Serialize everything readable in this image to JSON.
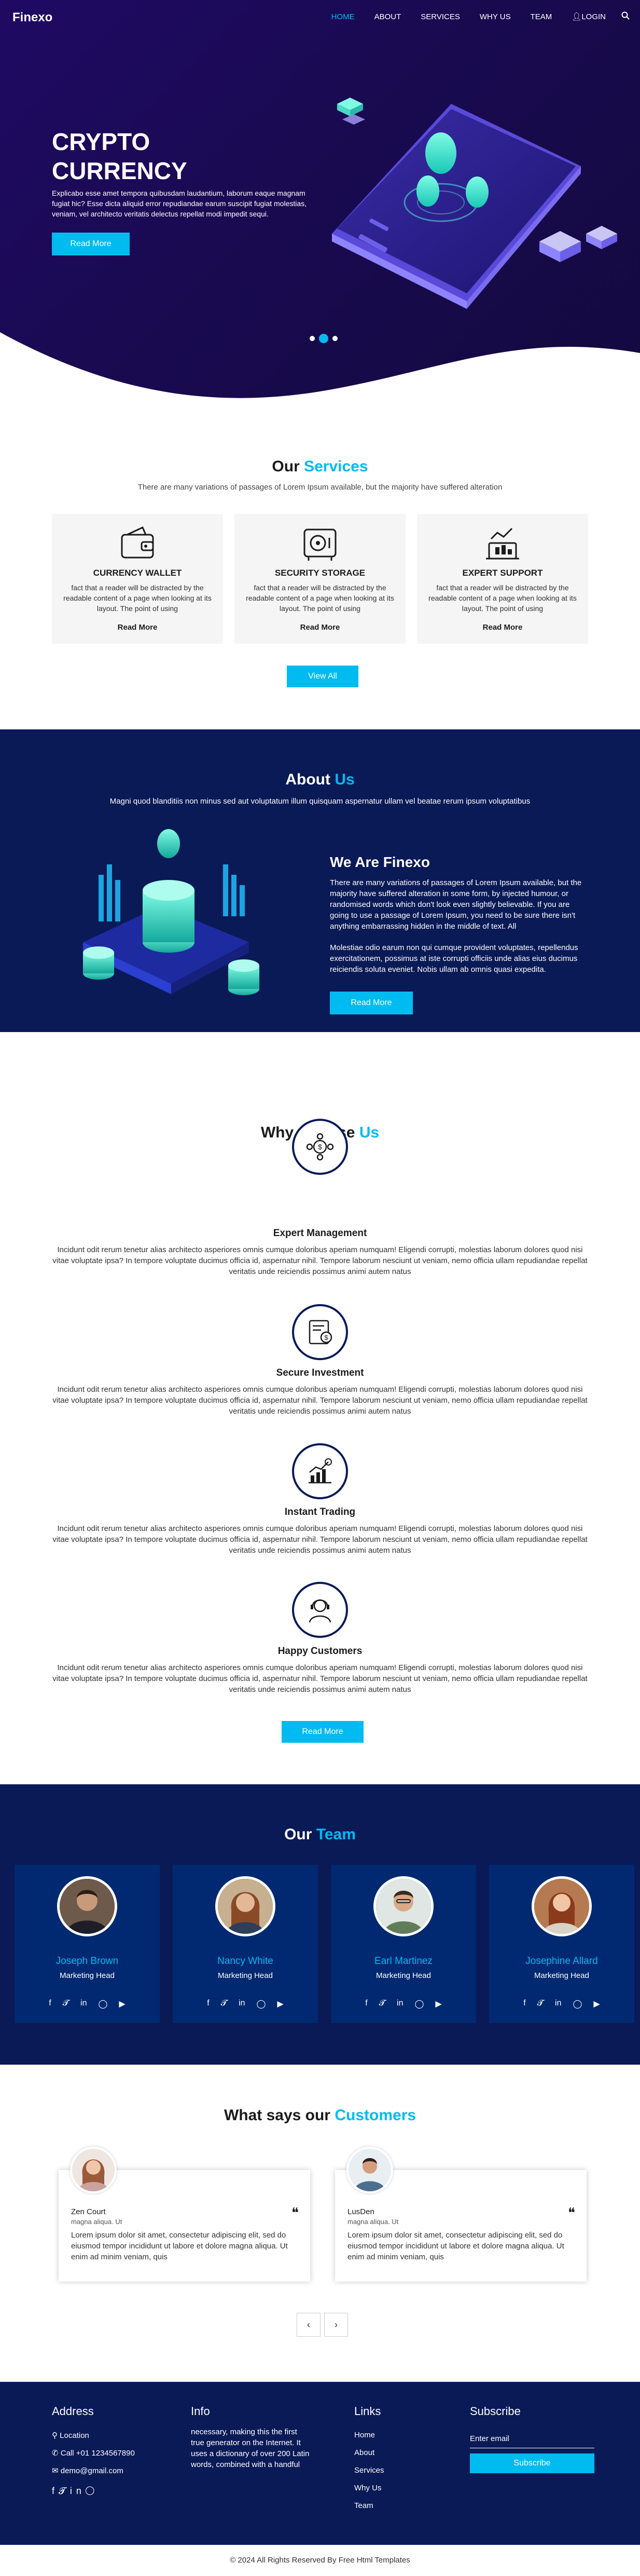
{
  "header": {
    "logo": "Finexo",
    "nav": [
      "HOME",
      "ABOUT",
      "SERVICES",
      "WHY US",
      "TEAM"
    ],
    "login": "LOGIN",
    "user_icon": "user-icon",
    "search_icon": "search-icon"
  },
  "hero": {
    "title_line1": "CRYPTO",
    "title_line2": "CURRENCY",
    "text": "Explicabo esse amet tempora quibusdam laudantium, laborum eaque magnam fugiat hic? Esse dicta aliquid error repudiandae earum suscipit fugiat molestias, veniam, vel architecto veritatis delectus repellat modi impedit sequi.",
    "button": "Read More",
    "carousel_active_index": 1
  },
  "services": {
    "title_a": "Our",
    "title_b": "Services",
    "subtitle": "There are many variations of passages of Lorem Ipsum available, but the majority have suffered alteration",
    "cards": [
      {
        "title": "CURRENCY WALLET",
        "desc": "fact that a reader will be distracted by the readable content of a page when looking at its layout. The point of using",
        "link": "Read More"
      },
      {
        "title": "SECURITY STORAGE",
        "desc": "fact that a reader will be distracted by the readable content of a page when looking at its layout. The point of using",
        "link": "Read More"
      },
      {
        "title": "EXPERT SUPPORT",
        "desc": "fact that a reader will be distracted by the readable content of a page when looking at its layout. The point of using",
        "link": "Read More"
      }
    ],
    "button": "View All"
  },
  "about": {
    "title_a": "About",
    "title_b": "Us",
    "subtitle": "Magni quod blanditiis non minus sed aut voluptatum illum quisquam aspernatur ullam vel beatae rerum ipsum voluptatibus",
    "heading": "We Are Finexo",
    "p1": "There are many variations of passages of Lorem Ipsum available, but the majority have suffered alteration in some form, by injected humour, or randomised words which don't look even slightly believable. If you are going to use a passage of Lorem Ipsum, you need to be sure there isn't anything embarrassing hidden in the middle of text. All",
    "p2": "Molestiae odio earum non qui cumque provident voluptates, repellendus exercitationem, possimus at iste corrupti officiis unde alias eius ducimus reiciendis soluta eveniet. Nobis ullam ab omnis quasi expedita.",
    "button": "Read More"
  },
  "why": {
    "title_a": "Why Choose",
    "title_b": "Us",
    "items": [
      {
        "title": "Expert Management",
        "desc": "Incidunt odit rerum tenetur alias architecto asperiores omnis cumque doloribus aperiam numquam! Eligendi corrupti, molestias laborum dolores quod nisi vitae voluptate ipsa? In tempore voluptate ducimus officia id, aspernatur nihil. Tempore laborum nesciunt ut veniam, nemo officia ullam repudiandae repellat veritatis unde reiciendis possimus animi autem natus",
        "icon": "management-icon"
      },
      {
        "title": "Secure Investment",
        "desc": "Incidunt odit rerum tenetur alias architecto asperiores omnis cumque doloribus aperiam numquam! Eligendi corrupti, molestias laborum dolores quod nisi vitae voluptate ipsa? In tempore voluptate ducimus officia id, aspernatur nihil. Tempore laborum nesciunt ut veniam, nemo officia ullam repudiandae repellat veritatis unde reiciendis possimus animi autem natus",
        "icon": "investment-icon"
      },
      {
        "title": "Instant Trading",
        "desc": "Incidunt odit rerum tenetur alias architecto asperiores omnis cumque doloribus aperiam numquam! Eligendi corrupti, molestias laborum dolores quod nisi vitae voluptate ipsa? In tempore voluptate ducimus officia id, aspernatur nihil. Tempore laborum nesciunt ut veniam, nemo officia ullam repudiandae repellat veritatis unde reiciendis possimus animi autem natus",
        "icon": "trading-icon"
      },
      {
        "title": "Happy Customers",
        "desc": "Incidunt odit rerum tenetur alias architecto asperiores omnis cumque doloribus aperiam numquam! Eligendi corrupti, molestias laborum dolores quod nisi vitae voluptate ipsa? In tempore voluptate ducimus officia id, aspernatur nihil. Tempore laborum nesciunt ut veniam, nemo officia ullam repudiandae repellat veritatis unde reiciendis possimus animi autem natus",
        "icon": "customers-icon"
      }
    ],
    "button": "Read More"
  },
  "team": {
    "title_a": "Our",
    "title_b": "Team",
    "members": [
      {
        "name": "Joseph Brown",
        "role": "Marketing Head"
      },
      {
        "name": "Nancy White",
        "role": "Marketing Head"
      },
      {
        "name": "Earl Martinez",
        "role": "Marketing Head"
      },
      {
        "name": "Josephine Allard",
        "role": "Marketing Head"
      }
    ],
    "social": [
      "f",
      "t",
      "in",
      "ig",
      "yt"
    ]
  },
  "clients": {
    "title_a": "What says our",
    "title_b": "Customers",
    "items": [
      {
        "name": "Zen Court",
        "role": "magna aliqua. Ut",
        "text": "Lorem ipsum dolor sit amet, consectetur adipiscing elit, sed do eiusmod tempor incididunt ut labore et dolore magna aliqua. Ut enim ad minim veniam, quis"
      },
      {
        "name": "LusDen",
        "role": "magna aliqua. Ut",
        "text": "Lorem ipsum dolor sit amet, consectetur adipiscing elit, sed do eiusmod tempor incididunt ut labore et dolore magna aliqua. Ut enim ad minim veniam, quis"
      }
    ],
    "prev": "‹",
    "next": "›"
  },
  "footer": {
    "address_head": "Address",
    "location": "Location",
    "phone": "Call +01 1234567890",
    "email": "demo@gmail.com",
    "info_head": "Info",
    "info_text": "necessary, making this the first true generator on the Internet. It uses a dictionary of over 200 Latin words, combined with a handful",
    "links_head": "Links",
    "links": [
      "Home",
      "About",
      "Services",
      "Why Us",
      "Team"
    ],
    "subscribe_head": "Subscribe",
    "email_placeholder": "Enter email",
    "subscribe_button": "Subscribe",
    "copyright": "© 2024 All Rights Reserved By Free Html Templates"
  },
  "colors": {
    "accent": "#00bbf0",
    "navy": "#0a1a56",
    "hero_bg": "#1f0a63",
    "card_bg": "#012971"
  }
}
